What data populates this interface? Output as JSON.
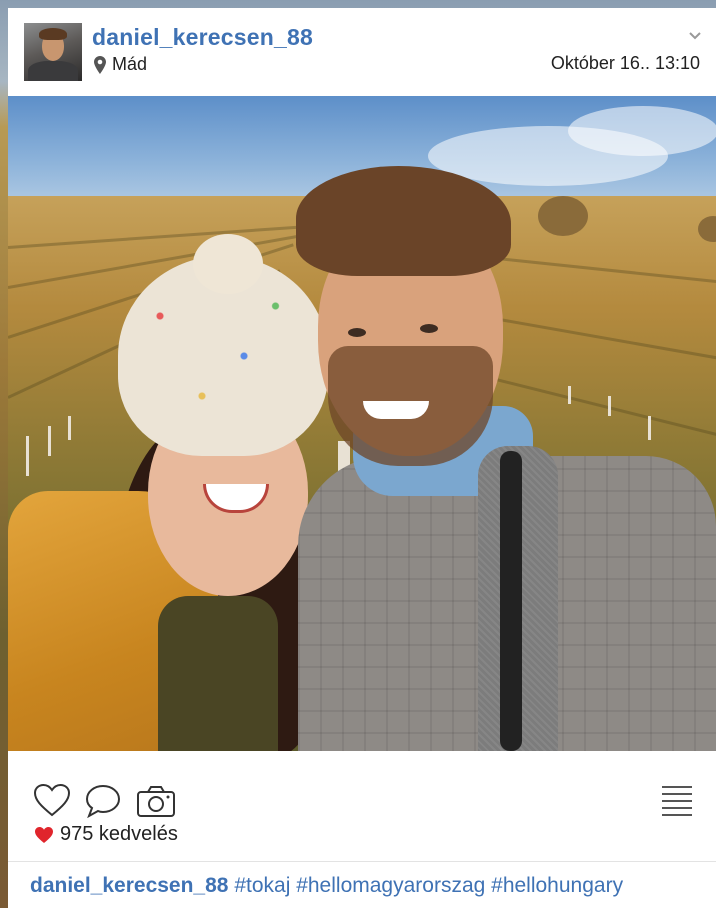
{
  "post": {
    "username": "daniel_kerecsen_88",
    "location": "Mád",
    "timestamp": "Október 16.. 13:10",
    "likes_text": "975 kedvelés",
    "caption_user": "daniel_kerecsen_88",
    "caption_text": "#tokaj #hellomagyarorszag #hellohungary"
  },
  "icons": {
    "location": "map-pin-icon",
    "menu": "chevron-down-icon",
    "like": "heart-outline-icon",
    "comment": "speech-bubble-icon",
    "camera": "camera-icon",
    "options": "hamburger-menu-icon",
    "liked": "heart-filled-icon"
  },
  "colors": {
    "username": "#3f72b4",
    "heart": "#e0252c"
  }
}
